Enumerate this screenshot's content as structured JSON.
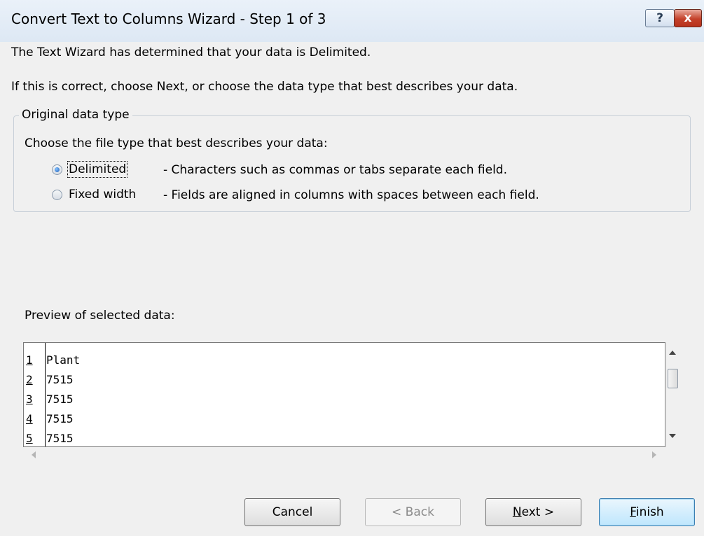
{
  "window": {
    "title": "Convert Text to Columns Wizard - Step 1 of 3",
    "help_label": "?",
    "close_label": "x"
  },
  "intro": {
    "line1": "The Text Wizard has determined that your data is Delimited.",
    "line2": "If this is correct, choose Next, or choose the data type that best describes your data."
  },
  "original_data_type": {
    "legend": "Original data type",
    "prompt": "Choose the file type that best describes your data:",
    "options": [
      {
        "label": "Delimited",
        "description": "- Characters such as commas or tabs separate each field.",
        "selected": true
      },
      {
        "label": "Fixed width",
        "description": "- Fields are aligned in columns with spaces between each field.",
        "selected": false
      }
    ]
  },
  "preview": {
    "label": "Preview of selected data:",
    "rows": [
      {
        "num": "1",
        "value": "Plant"
      },
      {
        "num": "2",
        "value": "7515"
      },
      {
        "num": "3",
        "value": "7515"
      },
      {
        "num": "4",
        "value": "7515"
      },
      {
        "num": "5",
        "value": "7515"
      }
    ]
  },
  "buttons": {
    "cancel": "Cancel",
    "back": "< Back",
    "next": "Next >",
    "finish": "Finish"
  },
  "colors": {
    "dialog_bg": "#f0f0f0",
    "close_button": "#c4412a",
    "default_button_border": "#3c7fb1"
  },
  "icons": {
    "help": "help-icon",
    "close": "close-icon"
  }
}
